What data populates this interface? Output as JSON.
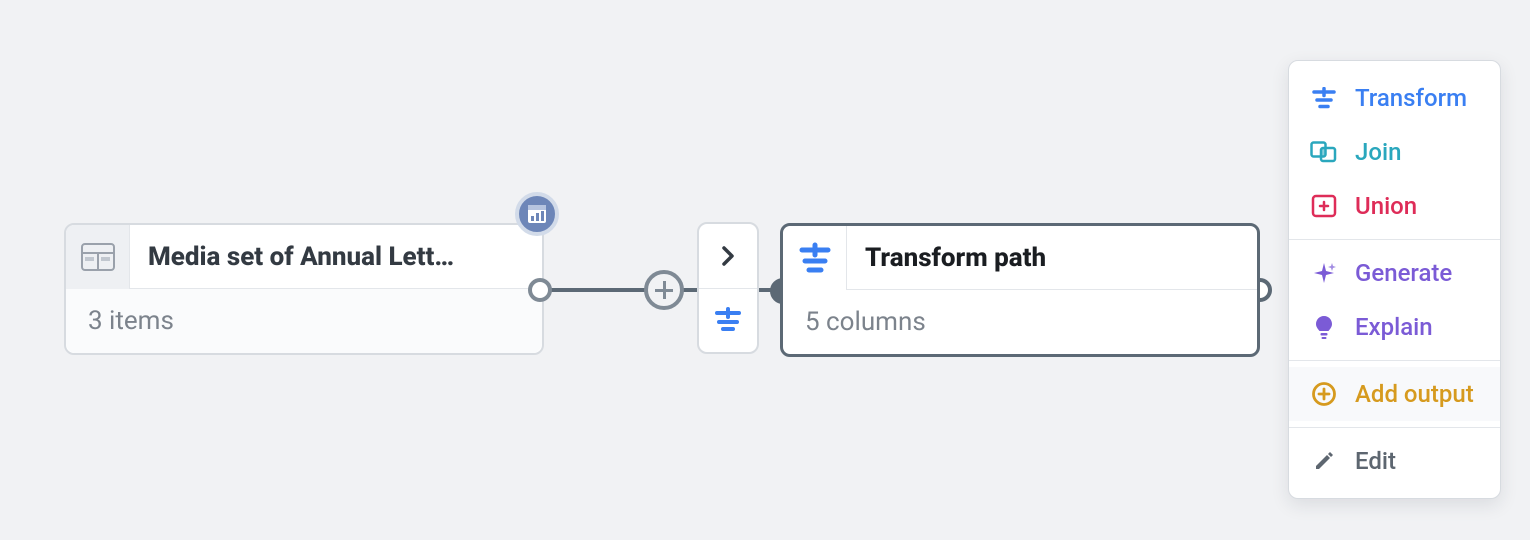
{
  "source_node": {
    "title": "Media set of Annual Lett…",
    "subtitle": "3 items",
    "icon": "table-icon"
  },
  "transform_node": {
    "title": "Transform path",
    "subtitle": "5 columns",
    "icon": "transform-icon"
  },
  "mid_buttons": {
    "top_icon": "chevron-right-icon",
    "bottom_icon": "transform-icon"
  },
  "badge": {
    "icon": "sheet-chart-icon"
  },
  "menu": {
    "items": [
      {
        "label": "Transform",
        "icon": "transform-icon",
        "color": "c-blue"
      },
      {
        "label": "Join",
        "icon": "join-icon",
        "color": "c-teal"
      },
      {
        "label": "Union",
        "icon": "union-icon",
        "color": "c-red"
      }
    ],
    "items2": [
      {
        "label": "Generate",
        "icon": "sparkle-icon",
        "color": "c-purple"
      },
      {
        "label": "Explain",
        "icon": "bulb-icon",
        "color": "c-purple"
      }
    ],
    "items3": [
      {
        "label": "Add output",
        "icon": "plus-circle-icon",
        "color": "c-gold",
        "highlight": true
      }
    ],
    "items4": [
      {
        "label": "Edit",
        "icon": "pencil-icon",
        "color": "c-gray"
      }
    ]
  }
}
